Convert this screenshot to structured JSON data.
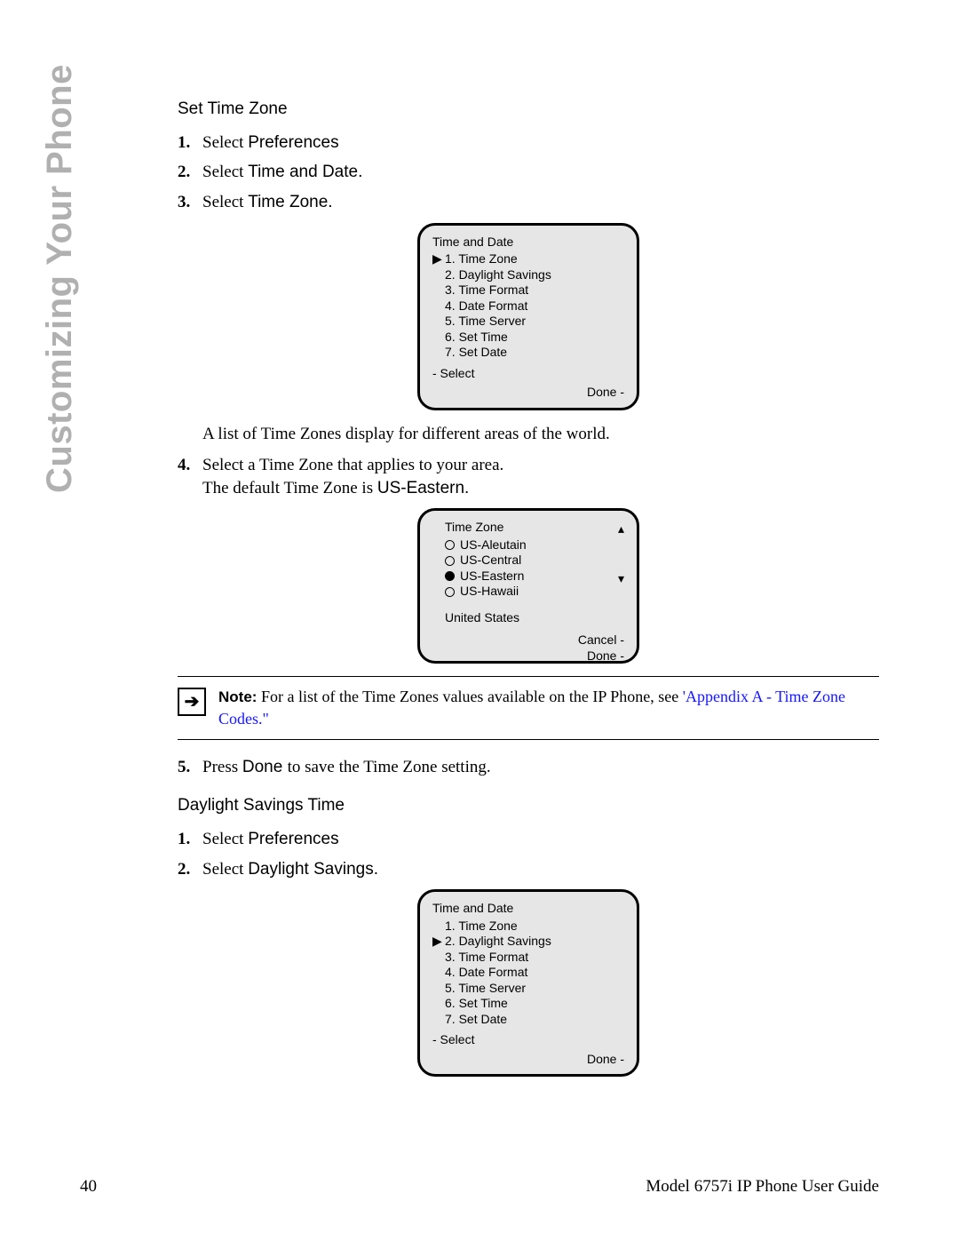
{
  "sideTitle": "Customizing Your Phone",
  "heading1": "Set Time Zone",
  "steps1": {
    "s1a": "Select ",
    "s1b": "Preferences",
    "s2a": "Select ",
    "s2b": "Time and Date.",
    "s3a": "Select ",
    "s3b": "Time Zone."
  },
  "screen1": {
    "title": "Time and Date",
    "items": [
      "1. Time Zone",
      "2. Daylight Savings",
      "3. Time Format",
      "4. Date Format",
      "5. Time Server",
      "6. Set Time",
      "7. Set Date"
    ],
    "select": "- Select",
    "done": "Done -"
  },
  "afterScreen1": "A list of Time Zones display for different areas of the world.",
  "steps2": {
    "s4a": "Select a Time Zone that applies to your area.",
    "s4b": "The default Time Zone is ",
    "s4c": "US-Eastern."
  },
  "screen2": {
    "title": "Time Zone",
    "options": [
      "US-Aleutain",
      "US-Central",
      "US-Eastern",
      "US-Hawaii"
    ],
    "selectedIndex": 2,
    "region": "United States",
    "cancel": "Cancel -",
    "done": "Done -"
  },
  "note": {
    "label": "Note:",
    "text": " For a list of the Time Zones values available on the IP Phone, see ",
    "link": "'Appendix A - Time Zone Codes.\""
  },
  "steps3": {
    "s5a": "Press ",
    "s5b": "Done ",
    "s5c": "to save the Time Zone setting."
  },
  "heading2": "Daylight Savings Time",
  "steps4": {
    "s1a": "Select ",
    "s1b": "Preferences",
    "s2a": "Select ",
    "s2b": "Daylight Savings."
  },
  "screen3": {
    "title": "Time and Date",
    "items": [
      "1. Time Zone",
      "2. Daylight Savings",
      "3. Time Format",
      "4. Date Format",
      "5. Time Server",
      "6. Set Time",
      "7. Set Date"
    ],
    "select": "- Select",
    "done": "Done -"
  },
  "footer": {
    "page": "40",
    "guide": "Model 6757i IP Phone User Guide"
  }
}
